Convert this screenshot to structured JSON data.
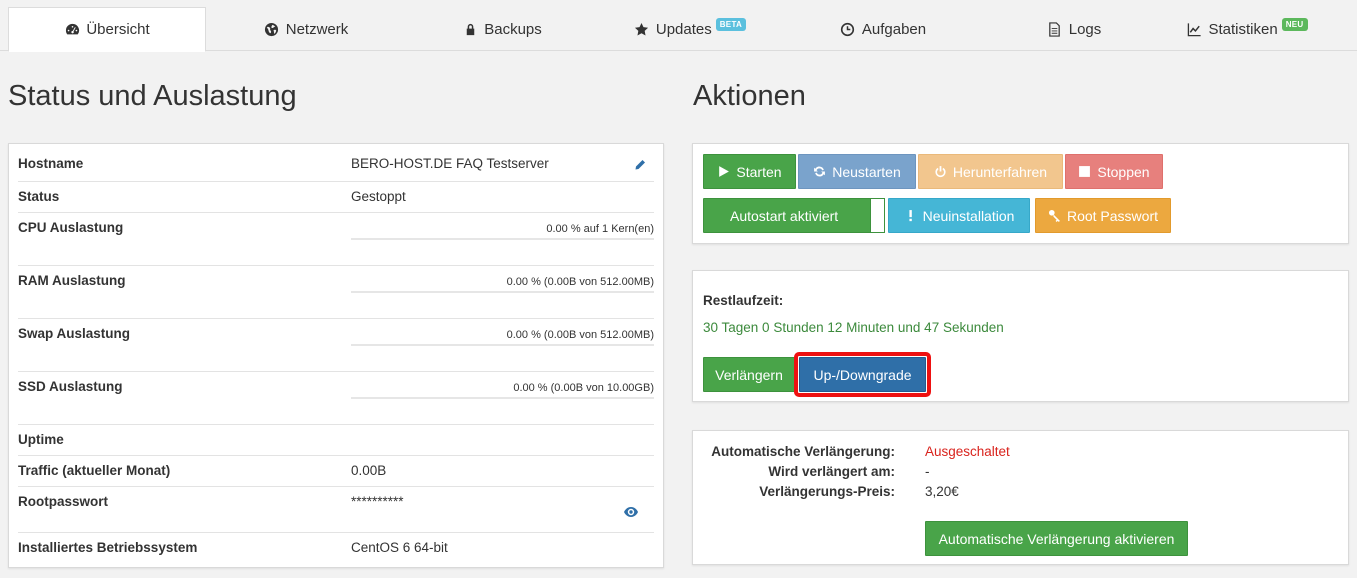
{
  "tabs": [
    {
      "label": "Übersicht",
      "icon": "dashboard-icon",
      "active": true
    },
    {
      "label": "Netzwerk",
      "icon": "globe-icon"
    },
    {
      "label": "Backups",
      "icon": "lock-icon"
    },
    {
      "label": "Updates",
      "icon": "star-icon",
      "badge": "BETA"
    },
    {
      "label": "Aufgaben",
      "icon": "clock-icon"
    },
    {
      "label": "Logs",
      "icon": "file-icon"
    },
    {
      "label": "Statistiken",
      "icon": "line-chart-icon",
      "badge": "NEU"
    }
  ],
  "status": {
    "heading": "Status und Auslastung",
    "hostname_label": "Hostname",
    "hostname_value": "BERO-HOST.DE FAQ Testserver",
    "status_label": "Status",
    "status_value": "Gestoppt",
    "cpu_label": "CPU Auslastung",
    "cpu_value": "0.00 % auf 1 Kern(en)",
    "ram_label": "RAM Auslastung",
    "ram_value": "0.00 % (0.00B von 512.00MB)",
    "swap_label": "Swap Auslastung",
    "swap_value": "0.00 % (0.00B von 512.00MB)",
    "ssd_label": "SSD Auslastung",
    "ssd_value": "0.00 % (0.00B von 10.00GB)",
    "uptime_label": "Uptime",
    "traffic_label": "Traffic (aktueller Monat)",
    "traffic_value": "0.00B",
    "rootpw_label": "Rootpasswort",
    "rootpw_value": "**********",
    "os_label": "Installiertes Betriebssystem",
    "os_value": "CentOS 6 64-bit",
    "usage_fractions": {
      "cpu": 0,
      "ram": 0,
      "swap": 0,
      "ssd": 0
    }
  },
  "actions": {
    "heading": "Aktionen",
    "start": "Starten",
    "restart": "Neustarten",
    "shutdown": "Herunterfahren",
    "stop": "Stoppen",
    "autostart": "Autostart aktiviert",
    "reinstall": "Neuinstallation",
    "rootpw": "Root Passwort"
  },
  "runtime": {
    "label": "Restlaufzeit:",
    "value": "30 Tagen 0 Stunden 12 Minuten und 47 Sekunden",
    "extend": "Verlängern",
    "updown": "Up-/Downgrade"
  },
  "renewal": {
    "auto_label": "Automatische Verlängerung:",
    "auto_value": "Ausgeschaltet",
    "renew_on_label": "Wird verlängert am:",
    "renew_on_value": "-",
    "price_label": "Verlängerungs-Preis:",
    "price_value": "3,20€",
    "activate": "Automatische Verlängerung aktivieren"
  },
  "colors": {
    "green": "#49a449",
    "red": "#d9231d",
    "primary": "#2f6fa8",
    "highlight": "#ee1111"
  }
}
